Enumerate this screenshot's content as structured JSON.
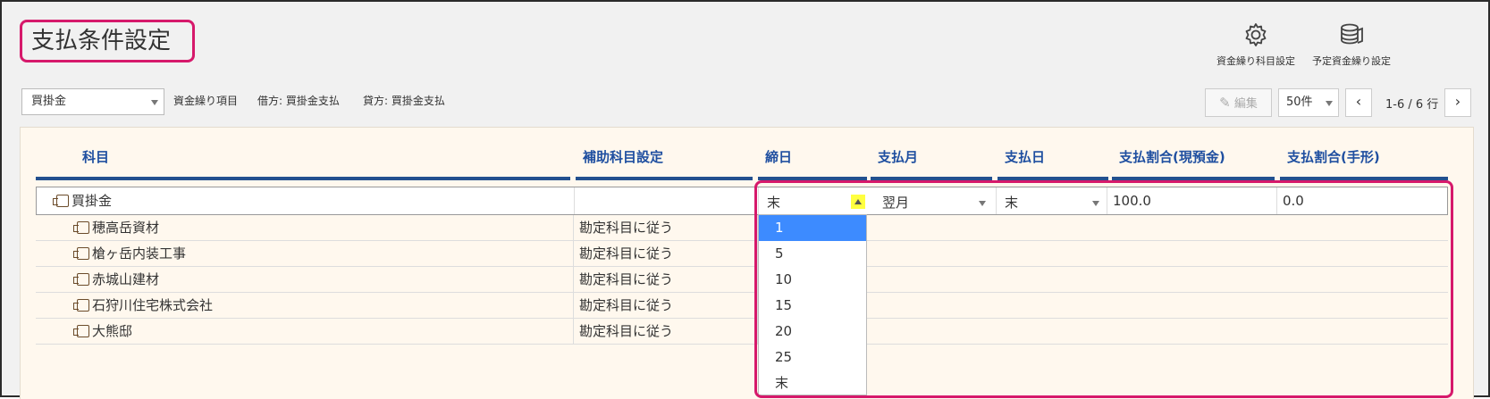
{
  "header": {
    "title": "支払条件設定",
    "actions": [
      {
        "label": "資金繰り科目設定",
        "icon": "gear-icon"
      },
      {
        "label": "予定資金繰り設定",
        "icon": "database-icon"
      }
    ]
  },
  "toolbar": {
    "subject_select": "買掛金",
    "fund_item_label": "資金繰り項目",
    "debit": "借方: 買掛金支払",
    "credit": "貸方: 買掛金支払",
    "edit_label": "編集",
    "per_page": "50件",
    "prev": "‹",
    "next": "›",
    "range": "1-6 / 6 行"
  },
  "table": {
    "columns": [
      "科目",
      "補助科目設定",
      "締日",
      "支払月",
      "支払日",
      "支払割合(現預金)",
      "支払割合(手形)"
    ],
    "main_row": {
      "subject": "買掛金",
      "closing_day": "末",
      "pay_month": "翌月",
      "pay_day": "末",
      "ratio_cash": "100.0",
      "ratio_bill": "0.0"
    },
    "sub_rows": [
      {
        "subject": "穂高岳資材",
        "setting": "勘定科目に従う"
      },
      {
        "subject": "槍ヶ岳内装工事",
        "setting": "勘定科目に従う"
      },
      {
        "subject": "赤城山建材",
        "setting": "勘定科目に従う"
      },
      {
        "subject": "石狩川住宅株式会社",
        "setting": "勘定科目に従う"
      },
      {
        "subject": "大熊邸",
        "setting": "勘定科目に従う"
      }
    ]
  },
  "dropdown": {
    "options": [
      "1",
      "5",
      "10",
      "15",
      "20",
      "25",
      "末"
    ],
    "selected_index": 0
  },
  "colors": {
    "highlight": "#d6196b",
    "header_text": "#1f4fa0",
    "header_rule": "#23508f",
    "selected_option": "#3d8bff"
  }
}
